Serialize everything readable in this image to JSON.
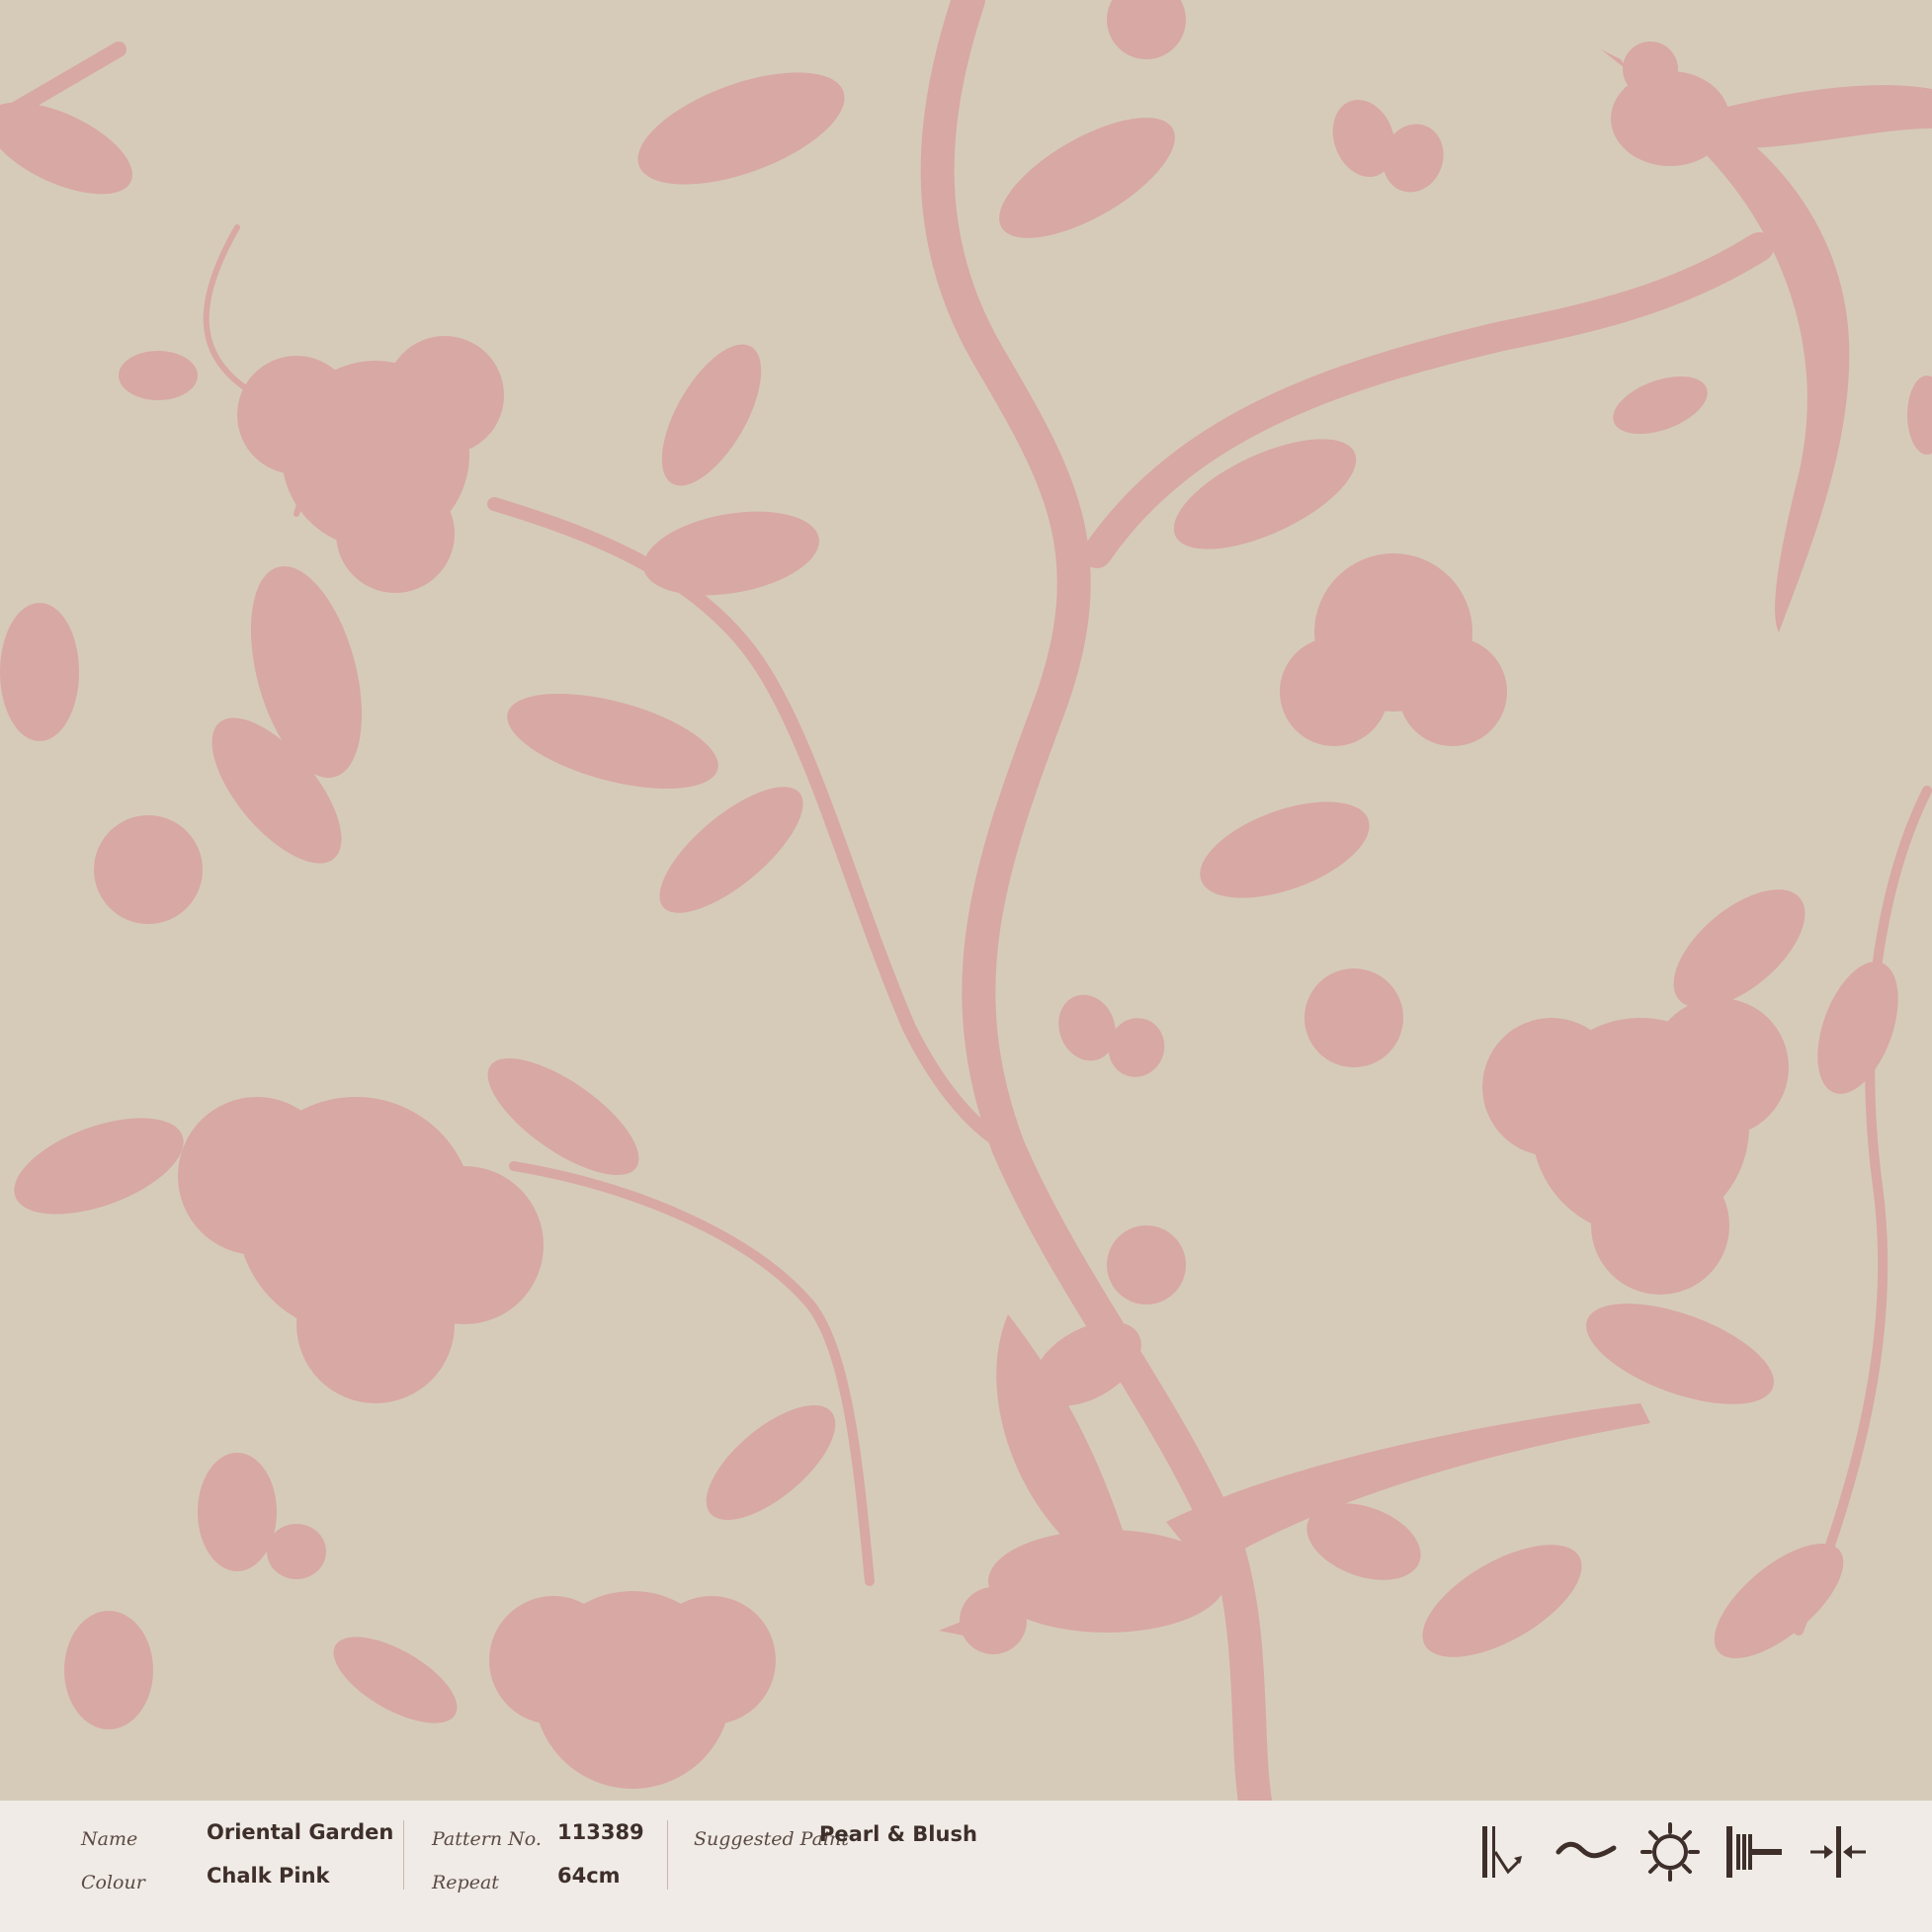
{
  "colors": {
    "background": "#d6cbb9",
    "motif": "#d8a8a4",
    "info_bar": "#f0ebe6",
    "text": "#3e2f2a"
  },
  "pattern": {
    "motifs": [
      "bird-silhouette",
      "peony-flower",
      "leaf-spray",
      "butterfly",
      "branch"
    ]
  },
  "info": {
    "name_label": "Name",
    "name_value": "Oriental Garden",
    "colour_label": "Colour",
    "colour_value": "Chalk Pink",
    "pattern_label": "Pattern No.",
    "pattern_value": "113389",
    "repeat_label": "Repeat",
    "repeat_value": "64cm",
    "paint_label": "Suggested Paint",
    "paint_value": "Pearl & Blush"
  },
  "icons": [
    "straight-match-icon",
    "spongeable-icon",
    "light-fastness-icon",
    "paste-the-wall-icon",
    "butt-join-icon"
  ]
}
